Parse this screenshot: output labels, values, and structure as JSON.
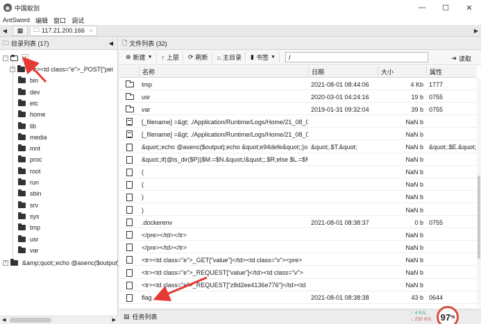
{
  "window": {
    "title": "中国蚁剑",
    "min": "—",
    "max": "☐",
    "close": "✕"
  },
  "menu": [
    "AntSword",
    "编辑",
    "窗口",
    "调试"
  ],
  "tabs": {
    "session": "117.21.200.166",
    "close": "✕"
  },
  "left": {
    "header": "目录列表 (17)",
    "root": "/",
    "items": [
      "<tr><td class=\"e\">_POST[\"pei",
      "bin",
      "dev",
      "etc",
      "home",
      "lib",
      "media",
      "mnt",
      "proc",
      "root",
      "run",
      "sbin",
      "srv",
      "sys",
      "tmp",
      "usr",
      "var"
    ],
    "bottom_item": "&amp;quot;;echo @asenc($output)"
  },
  "right": {
    "header": "文件列表 (32)",
    "toolbar": {
      "new": "新建",
      "up": "上层",
      "refresh": "刷新",
      "home": "主目录",
      "bookmark": "书签",
      "path": "/",
      "read": "读取"
    },
    "columns": [
      "名称",
      "日期",
      "大小",
      "属性"
    ],
    "rows": [
      {
        "type": "dir",
        "name": "tmp",
        "date": "2021-08-01 08:44:06",
        "size": "4 Kb",
        "attr": "1777"
      },
      {
        "type": "dir",
        "name": "usr",
        "date": "2020-03-01 04:24:16",
        "size": "19 b",
        "attr": "0755"
      },
      {
        "type": "dir",
        "name": "var",
        "date": "2019-01-31 09:32:04",
        "size": "39 b",
        "attr": "0755"
      },
      {
        "type": "txt",
        "name": "[_filename] =&gt; ./Application/Runtime/Logs/Home/21_08_0",
        "date": "",
        "size": "NaN b",
        "attr": ""
      },
      {
        "type": "txt",
        "name": "[_filename] =&gt; ./Application/Runtime/Logs/Home/21_08_0",
        "date": "",
        "size": "NaN b",
        "attr": ""
      },
      {
        "type": "file",
        "name": "&quot;;echo @asenc($output);echo &quot;e94defe&quot;;}o",
        "date": "&quot;.$T.&quot;",
        "size": "NaN b",
        "attr": "&quot;.$E.&quot;"
      },
      {
        "type": "file",
        "name": "&quot;;if(@is_dir($P))$M.=$N.&quot;/&quot;;.$R;else $L.=$N",
        "date": "",
        "size": "NaN b",
        "attr": ""
      },
      {
        "type": "file",
        "name": "(",
        "date": "",
        "size": "NaN b",
        "attr": ""
      },
      {
        "type": "file",
        "name": "(",
        "date": "",
        "size": "NaN b",
        "attr": ""
      },
      {
        "type": "file",
        "name": ")",
        "date": "",
        "size": "NaN b",
        "attr": ""
      },
      {
        "type": "file",
        "name": ")",
        "date": "",
        "size": "NaN b",
        "attr": ""
      },
      {
        "type": "file",
        "name": ".dockerenv",
        "date": "2021-08-01 08:38:37",
        "size": "0 b",
        "attr": "0755"
      },
      {
        "type": "file",
        "name": "</pre></td></tr>",
        "date": "",
        "size": "NaN b",
        "attr": ""
      },
      {
        "type": "file",
        "name": "</pre></td></tr>",
        "date": "",
        "size": "NaN b",
        "attr": ""
      },
      {
        "type": "file",
        "name": "<tr><td class=\"e\">_GET[\"value\"]</td><td class=\"v\"><pre>",
        "date": "",
        "size": "NaN b",
        "attr": ""
      },
      {
        "type": "file",
        "name": "<tr><td class=\"e\">_REQUEST[\"value\"]</td><td class=\"v\">",
        "date": "",
        "size": "NaN b",
        "attr": ""
      },
      {
        "type": "file",
        "name": "<tr><td class=\"e\">_REQUEST[\"z8d2ee4136e776\"]</td><td",
        "date": "",
        "size": "NaN b",
        "attr": ""
      },
      {
        "type": "file",
        "name": "flag",
        "date": "2021-08-01 08:38:38",
        "size": "43 b",
        "attr": "0644"
      }
    ]
  },
  "task": {
    "label": "任务列表"
  },
  "net": {
    "up": "4",
    "up_unit": "K/s",
    "down": "232",
    "down_unit": "K/s",
    "gauge": "97",
    "gauge_unit": "%"
  },
  "colors": {
    "annotation": "#e53935"
  }
}
